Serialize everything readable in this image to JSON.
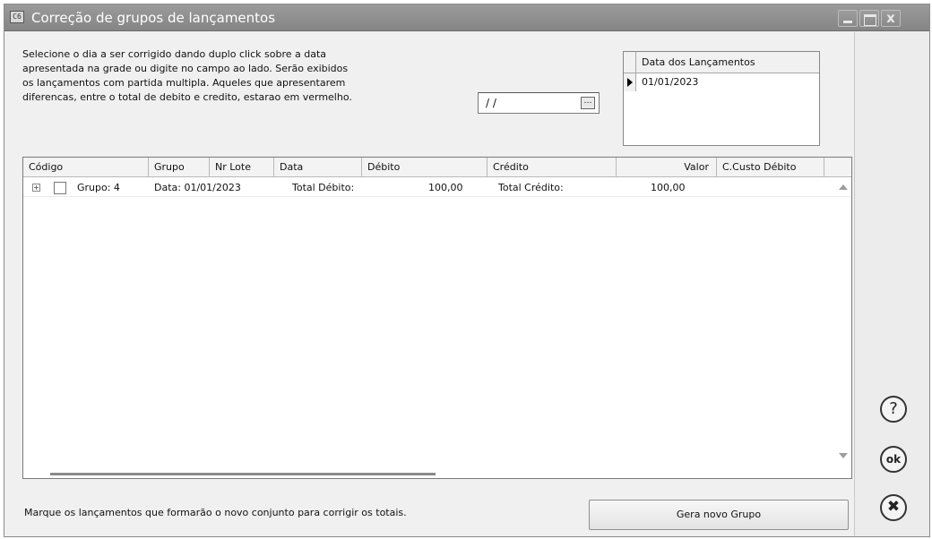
{
  "window": {
    "app_icon_text": "C6",
    "title": "Correção de grupos de lançamentos"
  },
  "instructions": [
    "Selecione o dia a ser corrigido dando duplo click sobre a data",
    "apresentada na grade ou digite no campo ao lado. Serão exibidos",
    "os lançamentos com partida multipla. Aqueles que apresentarem",
    "diferencas, entre o total de debito e credito, estarao em vermelho."
  ],
  "date_field": {
    "value": "/ /",
    "picker_glyph": "…"
  },
  "dates_grid": {
    "header": "Data dos Lançamentos",
    "rows": [
      "01/01/2023"
    ]
  },
  "main_grid": {
    "columns": [
      "Código",
      "Grupo",
      "Nr Lote",
      "Data",
      "Débito",
      "Crédito",
      "Valor",
      "C.Custo Débito"
    ],
    "group_row": {
      "expand_glyph": "+",
      "group": "Grupo: 4",
      "date": "Data: 01/01/2023",
      "debit_label": "Total Débito:",
      "debit_value": "100,00",
      "credit_label": "Total Crédito:",
      "credit_value": "100,00"
    }
  },
  "bottom": {
    "message": "Marque os lançamentos que formarão o novo conjunto para corrigir os totais.",
    "generate_button": "Gera novo Grupo"
  },
  "side_buttons": {
    "help": "?",
    "ok": "ok",
    "cancel": "✖"
  },
  "window_buttons": {
    "close": "x"
  },
  "colors": {
    "titlebar": "#8f8f8f",
    "title_text": "#ffffff",
    "window_bg": "#f0f0f0"
  }
}
